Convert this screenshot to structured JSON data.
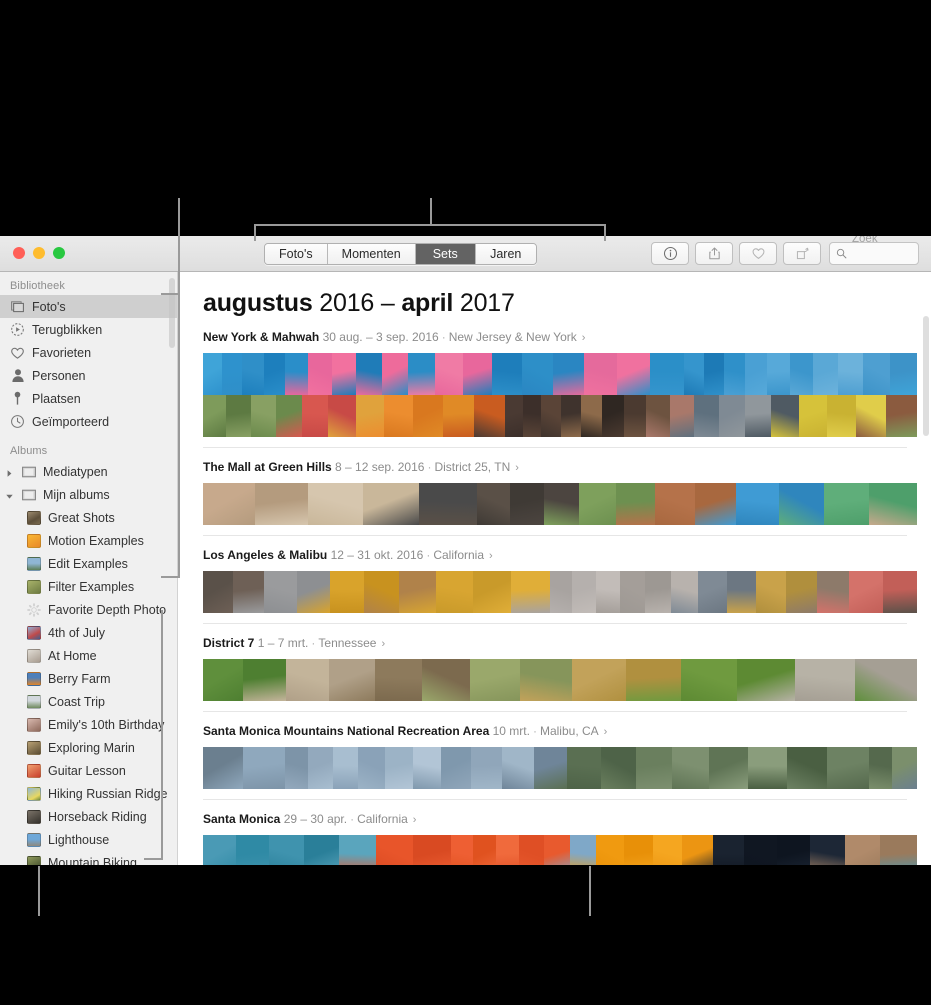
{
  "window": {
    "traffic_lights": [
      "close",
      "minimize",
      "zoom"
    ],
    "toolbar": {
      "segments": [
        {
          "label": "Foto's",
          "active": false
        },
        {
          "label": "Momenten",
          "active": false
        },
        {
          "label": "Sets",
          "active": true
        },
        {
          "label": "Jaren",
          "active": false
        }
      ],
      "buttons": [
        {
          "name": "info-button",
          "icon": "info-circle-icon"
        },
        {
          "name": "share-button",
          "icon": "share-up-arrow-icon"
        },
        {
          "name": "favorite-button",
          "icon": "heart-icon"
        },
        {
          "name": "rotate-button",
          "icon": "rotate-icon"
        }
      ],
      "search": {
        "placeholder": "Zoek",
        "value": "",
        "icon": "search-icon"
      }
    }
  },
  "sidebar": {
    "sections": [
      {
        "header": "Bibliotheek",
        "items": [
          {
            "label": "Foto's",
            "icon": "photos-icon",
            "selected": true
          },
          {
            "label": "Terugblikken",
            "icon": "memories-icon",
            "selected": false
          },
          {
            "label": "Favorieten",
            "icon": "heart-icon",
            "selected": false
          },
          {
            "label": "Personen",
            "icon": "person-icon",
            "selected": false
          },
          {
            "label": "Plaatsen",
            "icon": "pin-icon",
            "selected": false
          },
          {
            "label": "Geïmporteerd",
            "icon": "clock-icon",
            "selected": false
          }
        ]
      },
      {
        "header": "Albums",
        "items": [
          {
            "label": "Mediatypen",
            "icon": "folder-icon",
            "disclosure": "collapsed"
          },
          {
            "label": "Mijn albums",
            "icon": "folder-icon",
            "disclosure": "expanded"
          },
          {
            "label": "Great Shots",
            "icon": "album-thumb",
            "thumb": "#7a6a56",
            "indent": true
          },
          {
            "label": "Motion Examples",
            "icon": "album-thumb",
            "thumb": "#f5a623",
            "indent": true
          },
          {
            "label": "Edit Examples",
            "icon": "album-thumb",
            "thumb": "#6d8fb0",
            "indent": true
          },
          {
            "label": "Filter Examples",
            "icon": "album-thumb",
            "thumb": "#8a9a5b",
            "indent": true
          },
          {
            "label": "Favorite Depth Photo",
            "icon": "gear-icon",
            "indent": true
          },
          {
            "label": "4th of July",
            "icon": "album-thumb",
            "thumb": "#6b8fc0",
            "indent": true
          },
          {
            "label": "At Home",
            "icon": "album-thumb",
            "thumb": "#c9c2b6",
            "indent": true
          },
          {
            "label": "Berry Farm",
            "icon": "album-thumb",
            "thumb": "#d4822a",
            "indent": true
          },
          {
            "label": "Coast Trip",
            "icon": "album-thumb",
            "thumb": "#95a892",
            "indent": true
          },
          {
            "label": "Emily's 10th Birthday",
            "icon": "album-thumb",
            "thumb": "#c4a7a0",
            "indent": true
          },
          {
            "label": "Exploring Marin",
            "icon": "album-thumb",
            "thumb": "#8e7b5f",
            "indent": true
          },
          {
            "label": "Guitar Lesson",
            "icon": "album-thumb",
            "thumb": "#d96a4a",
            "indent": true
          },
          {
            "label": "Hiking Russian Ridge",
            "icon": "album-thumb",
            "thumb": "#d8c26b",
            "indent": true
          },
          {
            "label": "Horseback Riding",
            "icon": "album-thumb",
            "thumb": "#55524b",
            "indent": true
          },
          {
            "label": "Lighthouse",
            "icon": "album-thumb",
            "thumb": "#4f87b8",
            "indent": true
          },
          {
            "label": "Mountain Biking",
            "icon": "album-thumb",
            "thumb": "#5f6b3e",
            "indent": true
          }
        ]
      }
    ]
  },
  "main": {
    "title": {
      "month_start": "augustus",
      "year_start": "2016",
      "dash": "–",
      "month_end": "april",
      "year_end": "2017"
    },
    "groups": [
      {
        "name": "New York & Mahwah",
        "date": "30 aug. – 3 sep. 2016",
        "separator": "·",
        "place": "New Jersey & New York",
        "chevron": "›",
        "rows": 2,
        "photos": [
          [
            "#3fa4d8",
            "#2e92cd",
            "#2f8fc8",
            "#1d7fbd",
            "#2a8ec9",
            "#e8679c",
            "#f2719f",
            "#1f7cb8",
            "#ee6b9b",
            "#2b8dc6",
            "#f07ba5",
            "#e8679c",
            "#1e7ebb",
            "#2d8fc8",
            "#2a86c2",
            "#e56a9c",
            "#f0719f",
            "#2b8fc8",
            "#3595cd",
            "#1d7ab6",
            "#2f90c9",
            "#4aa0d4",
            "#57a9d9",
            "#3c96cc",
            "#5aa8d6",
            "#6cb2db",
            "#4e9fd1",
            "#3d93c8"
          ],
          [
            "#7e9b5b",
            "#5d7a42",
            "#88a063",
            "#6b8a4c",
            "#d8574f",
            "#c84a46",
            "#e0a23c",
            "#ec8d2f",
            "#d9781f",
            "#e08a26",
            "#c95c20",
            "#4a3a33",
            "#3c2f2a",
            "#5a4437",
            "#3f332d",
            "#8d6a4a",
            "#2f2722",
            "#4b3a30",
            "#6d5340",
            "#a9786a",
            "#5e707e",
            "#7f8a94",
            "#90979c",
            "#4f5a63",
            "#d6c23a",
            "#c9b232",
            "#e0cd4a",
            "#8b5b3f"
          ]
        ]
      },
      {
        "name": "The Mall at Green Hills",
        "date": "8 – 12 sep. 2016",
        "separator": "·",
        "place": "District 25, TN",
        "chevron": "›",
        "rows": 1,
        "photos": [
          [
            "#c7a98c",
            "#b49b7e",
            "#d6c6ae",
            "#c9b79a",
            "#4a4a4a",
            "#5a5047",
            "#3f3a35",
            "#4c4540",
            "#7ea05c",
            "#6d9050",
            "#b5724a",
            "#a8683f",
            "#3f9bd4",
            "#2f86bd",
            "#5fae7a",
            "#4e9f6b"
          ]
        ]
      },
      {
        "name": "Los Angeles & Malibu",
        "date": "12 – 31 okt. 2016",
        "separator": "·",
        "place": "California",
        "chevron": "›",
        "rows": 1,
        "photos": [
          [
            "#5a5149",
            "#6e6056",
            "#9a9b9d",
            "#8d8f92",
            "#d9a32b",
            "#c8921f",
            "#b0824a",
            "#d8a531",
            "#c99a2a",
            "#e0ae38",
            "#a8a3a0",
            "#b5b0ad",
            "#c2bcb8",
            "#a49e99",
            "#9d9893",
            "#b8b2ad",
            "#7f8a95",
            "#6c7782",
            "#c9a24a",
            "#b08f3d",
            "#8d7a6a",
            "#d4726a",
            "#c25f58"
          ]
        ]
      },
      {
        "name": "District 7",
        "date": "1 – 7 mrt.",
        "separator": "·",
        "place": "Tennessee",
        "chevron": "›",
        "rows": 1,
        "photos": [
          [
            "#5f8f3c",
            "#4e7f31",
            "#c3b49a",
            "#b0a088",
            "#8d7a5c",
            "#7c6a4e",
            "#9aa86b",
            "#86955b",
            "#c2a25a",
            "#b0903f",
            "#6f9a3f",
            "#5d8a33",
            "#b7b2a6",
            "#a59f94"
          ]
        ]
      },
      {
        "name": "Santa Monica Mountains National Recreation Area",
        "date": "10 mrt.",
        "separator": "·",
        "place": "Malibu, CA",
        "chevron": "›",
        "rows": 1,
        "photos": [
          [
            "#6b7f8f",
            "#8fa8bd",
            "#7d94a8",
            "#93a9bd",
            "#a8bed0",
            "#8aa2b8",
            "#9cb3c6",
            "#b2c5d6",
            "#7f98ad",
            "#90a6ba",
            "#a0b6c8",
            "#6f8599",
            "#5a6f52",
            "#4e6348",
            "#6a7f5e",
            "#7d9070",
            "#5f7455",
            "#8a9d7c",
            "#4a5f42",
            "#6d8263",
            "#55694d",
            "#7b8f6c"
          ]
        ]
      },
      {
        "name": "Santa Monica",
        "date": "29 – 30 apr.",
        "separator": "·",
        "place": "California",
        "chevron": "›",
        "rows": 1,
        "photos": [
          [
            "#4a9ab5",
            "#2f8aa5",
            "#3f93ae",
            "#2a7f99",
            "#5aa5bd",
            "#e8552a",
            "#d94a22",
            "#ee5f33",
            "#e0521f",
            "#f06a3c",
            "#df4f25",
            "#e85a2e",
            "#7fa8c8",
            "#f09a10",
            "#e89008",
            "#f5a620",
            "#ec9512",
            "#1a2330",
            "#101722",
            "#0e1520",
            "#1d2736",
            "#b08a6a",
            "#9a7a5c"
          ]
        ]
      }
    ]
  },
  "annotations": {
    "callout_color": "#9a9a9a"
  }
}
